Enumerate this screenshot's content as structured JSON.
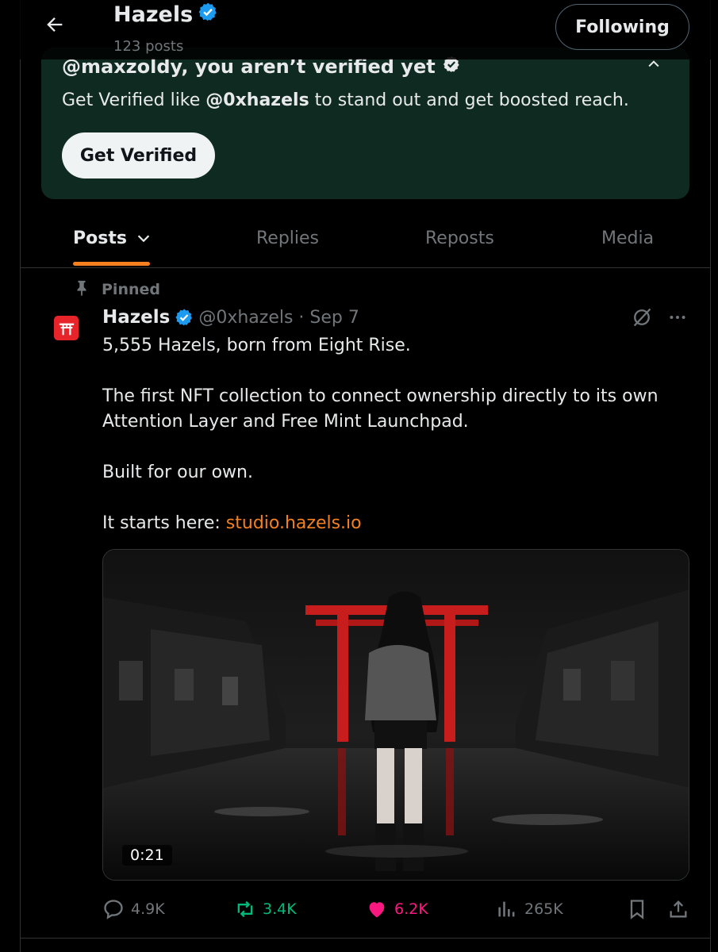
{
  "header": {
    "title": "Hazels",
    "subtitle": "123 posts",
    "follow_label": "Following"
  },
  "verify_card": {
    "title": "@maxzoldy, you aren’t verified yet",
    "text_prefix": "Get Verified like ",
    "text_handle": "@0xhazels",
    "text_suffix": " to stand out and get boosted reach.",
    "button_label": "Get Verified"
  },
  "tabs": [
    {
      "label": "Posts",
      "active": true
    },
    {
      "label": "Replies",
      "active": false
    },
    {
      "label": "Reposts",
      "active": false
    },
    {
      "label": "Media",
      "active": false
    }
  ],
  "post": {
    "pinned_label": "Pinned",
    "author_name": "Hazels",
    "meta": "@0xhazels · Sep 7",
    "lines": [
      "5,555 Hazels, born from Eight Rise.",
      "The first NFT collection to connect ownership directly to its own Attention Layer and Free Mint Launchpad.",
      "Built for our own.",
      "It starts here: "
    ],
    "link": "studio.hazels.io",
    "video_duration": "0:21",
    "stats": {
      "replies": "4.9K",
      "reposts": "3.4K",
      "likes": "6.2K",
      "views": "265K"
    }
  },
  "colors": {
    "accent": "#f4801f",
    "verified": "#1d9bf0",
    "verify_card_bg": "#0f2a20",
    "repost": "#00ba7c",
    "like": "#f91880",
    "muted": "#71767b"
  },
  "icons": [
    "back-arrow-icon",
    "verified-badge-icon",
    "chevron-up-icon",
    "chevron-down-icon",
    "pin-icon",
    "torii-icon",
    "grok-icon",
    "more-icon",
    "reply-icon",
    "repost-icon",
    "like-icon",
    "views-icon",
    "bookmark-icon",
    "share-icon"
  ]
}
